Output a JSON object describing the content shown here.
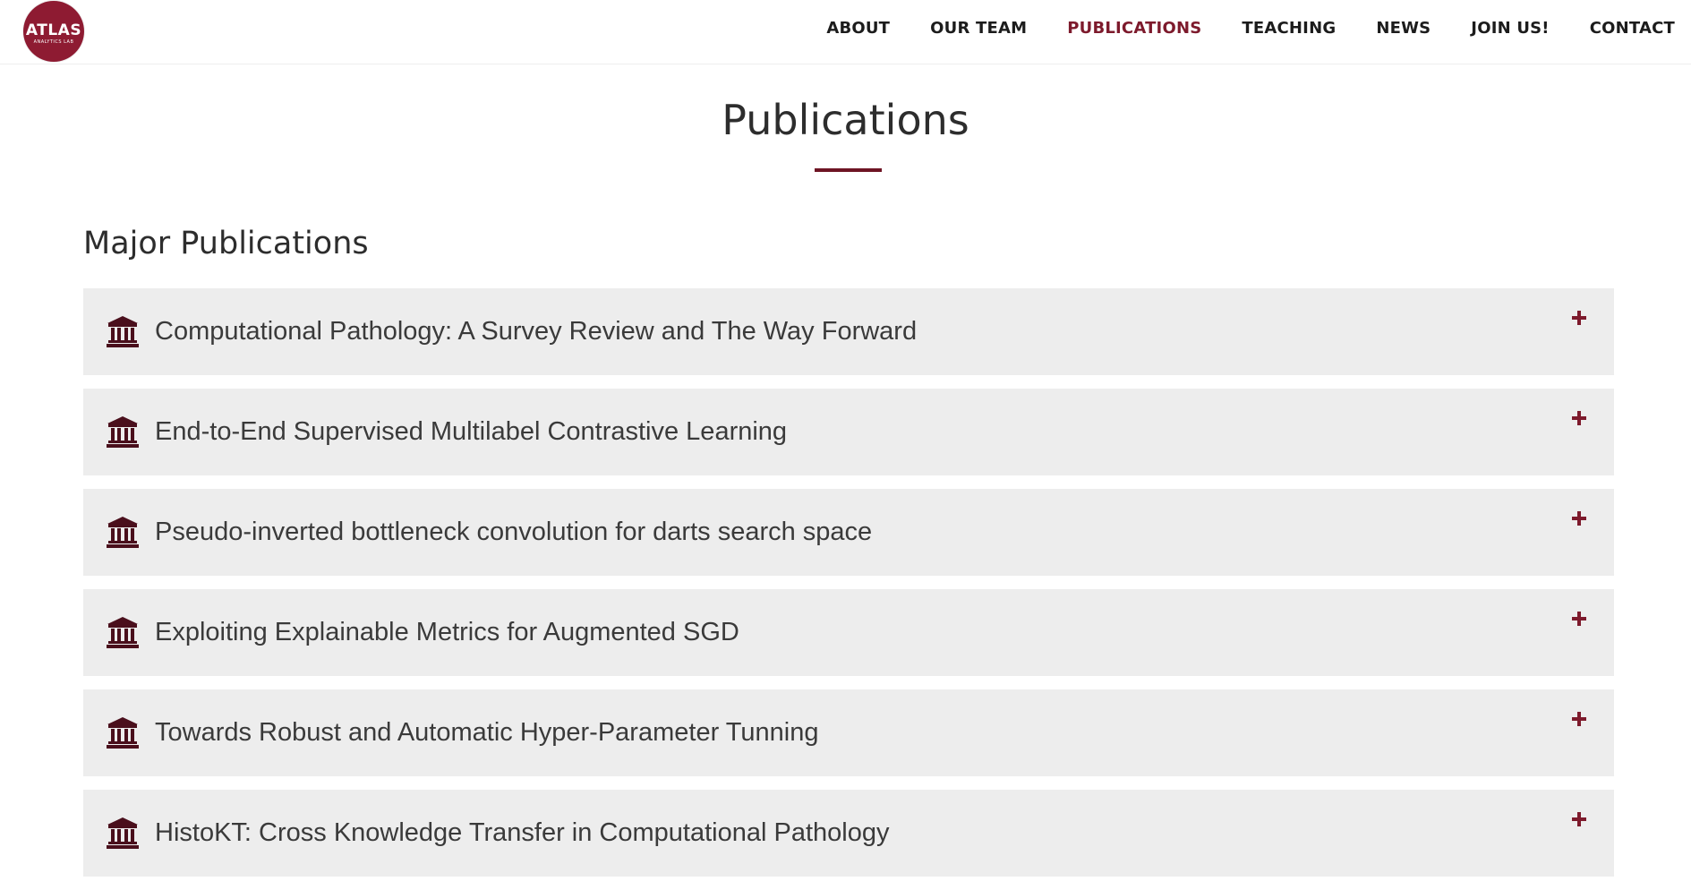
{
  "brand": {
    "logo_text": "ATLAS",
    "logo_subtext": "ANALYTICS LAB",
    "accent_color": "#7d1a2c"
  },
  "nav": {
    "items": [
      {
        "label": "ABOUT",
        "active": false
      },
      {
        "label": "OUR TEAM",
        "active": false
      },
      {
        "label": "PUBLICATIONS",
        "active": true
      },
      {
        "label": "TEACHING",
        "active": false
      },
      {
        "label": "NEWS",
        "active": false
      },
      {
        "label": "JOIN US!",
        "active": false
      },
      {
        "label": "CONTACT",
        "active": false
      }
    ]
  },
  "page": {
    "title": "Publications",
    "section_title": "Major Publications"
  },
  "publications": [
    {
      "title": "Computational Pathology: A Survey Review and The Way Forward",
      "icon": "institution-icon",
      "toggle": "plus-icon"
    },
    {
      "title": "End-to-End Supervised Multilabel Contrastive Learning",
      "icon": "institution-icon",
      "toggle": "plus-icon"
    },
    {
      "title": "Pseudo-inverted bottleneck convolution for darts search space",
      "icon": "institution-icon",
      "toggle": "plus-icon"
    },
    {
      "title": "Exploiting Explainable Metrics for Augmented SGD",
      "icon": "institution-icon",
      "toggle": "plus-icon"
    },
    {
      "title": "Towards Robust and Automatic Hyper-Parameter Tunning",
      "icon": "institution-icon",
      "toggle": "plus-icon"
    },
    {
      "title": "HistoKT: Cross Knowledge Transfer in Computational Pathology",
      "icon": "institution-icon",
      "toggle": "plus-icon"
    }
  ]
}
